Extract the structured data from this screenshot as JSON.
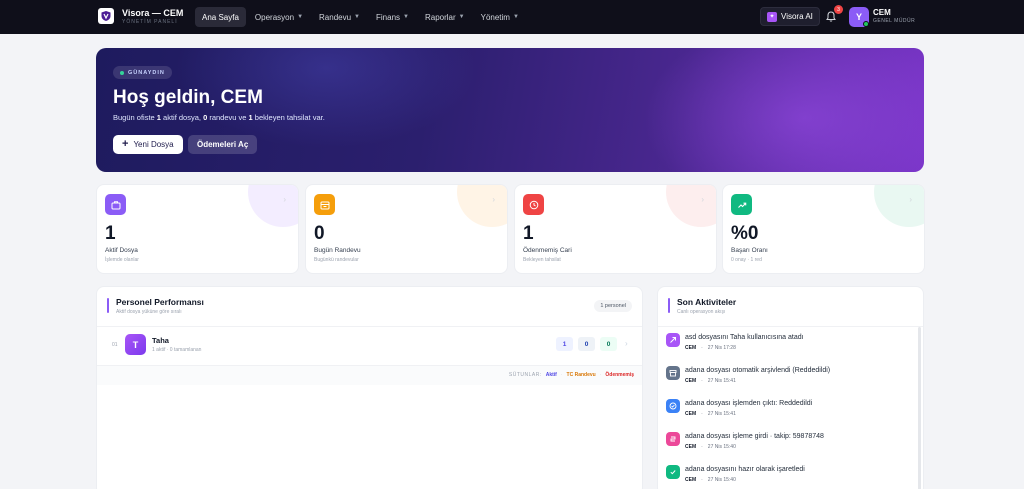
{
  "nav": {
    "brand_title": "Visora — CEM",
    "brand_sub": "YÖNETİM PANELİ",
    "menu": [
      {
        "label": "Ana Sayfa",
        "active": true,
        "dropdown": false
      },
      {
        "label": "Operasyon",
        "active": false,
        "dropdown": true
      },
      {
        "label": "Randevu",
        "active": false,
        "dropdown": true
      },
      {
        "label": "Finans",
        "active": false,
        "dropdown": true
      },
      {
        "label": "Raporlar",
        "active": false,
        "dropdown": true
      },
      {
        "label": "Yönetim",
        "active": false,
        "dropdown": true
      }
    ],
    "ai_label": "Visora AI",
    "notification_count": "3",
    "avatar_initial": "Y",
    "user_name": "CEM",
    "user_role": "GENEL MÜDÜR"
  },
  "hero": {
    "badge": "GÜNAYDIN",
    "title": "Hoş geldin, CEM",
    "desc_prefix": "Bugün ofiste ",
    "active_files": "1",
    "desc_mid1": " aktif dosya, ",
    "appointments": "0",
    "desc_mid2": " randevu ve ",
    "pending": "1",
    "desc_suffix": " bekleyen tahsilat var.",
    "new_file_label": "Yeni Dosya",
    "payments_label": "Ödemeleri Aç"
  },
  "stats": [
    {
      "value": "1",
      "label": "Aktif Dosya",
      "sub": "İşlemde olanlar",
      "icon": "briefcase-icon",
      "color": "#8b5cf6",
      "deco": "#f3edff"
    },
    {
      "value": "0",
      "label": "Bugün Randevu",
      "sub": "Bugünkü randevular",
      "icon": "calendar-icon",
      "color": "#f59e0b",
      "deco": "#fff4e6"
    },
    {
      "value": "1",
      "label": "Ödenmemiş Cari",
      "sub": "Bekleyen tahsilat",
      "icon": "clock-icon",
      "color": "#ef4444",
      "deco": "#fdeeee"
    },
    {
      "value": "%0",
      "label": "Başarı Oranı",
      "sub": "0 onay · 1 red",
      "icon": "trend-up-icon",
      "color": "#10b981",
      "deco": "#e9f8f2"
    }
  ],
  "performance": {
    "title": "Personel Performansı",
    "subtitle": "Aktif dosya yüküne göre sıralı",
    "count_label": "1 personel",
    "rows": [
      {
        "rank": "01",
        "initial": "T",
        "name": "Taha",
        "sub": "1 aktif · 0 tamamlanan",
        "aktif": "1",
        "randevu": "0",
        "odenmemis": "0"
      }
    ],
    "legend_title": "SÜTUNLAR:",
    "legend_aktif": "Aktif",
    "legend_randevu": "TC Randevu",
    "legend_odenmemis": "Ödenmemiş",
    "legend_sep": "·"
  },
  "activity": {
    "title": "Son Aktiviteler",
    "subtitle": "Canlı operasyon akışı",
    "items": [
      {
        "text": "asd dosyasını Taha kullanıcısına atadı",
        "user": "CEM",
        "time": "27 Nis 17:28",
        "color": "#a855f7",
        "icon": "assign-icon"
      },
      {
        "text": "adana dosyası otomatik arşivlendi (Reddedildi)",
        "user": "CEM",
        "time": "27 Nis 15:41",
        "color": "#64748b",
        "icon": "archive-icon"
      },
      {
        "text": "adana dosyası işlemden çıktı: Reddedildi",
        "user": "CEM",
        "time": "27 Nis 15:41",
        "color": "#3b82f6",
        "icon": "check-circle-icon"
      },
      {
        "text": "adana dosyası işleme girdi · takip: 59878748",
        "user": "CEM",
        "time": "27 Nis 15:40",
        "color": "#ec4899",
        "icon": "process-icon"
      },
      {
        "text": "adana dosyasını hazır olarak işaretledi",
        "user": "CEM",
        "time": "27 Nis 15:40",
        "color": "#10b981",
        "icon": "check-icon"
      }
    ],
    "meta_sep": "·"
  }
}
